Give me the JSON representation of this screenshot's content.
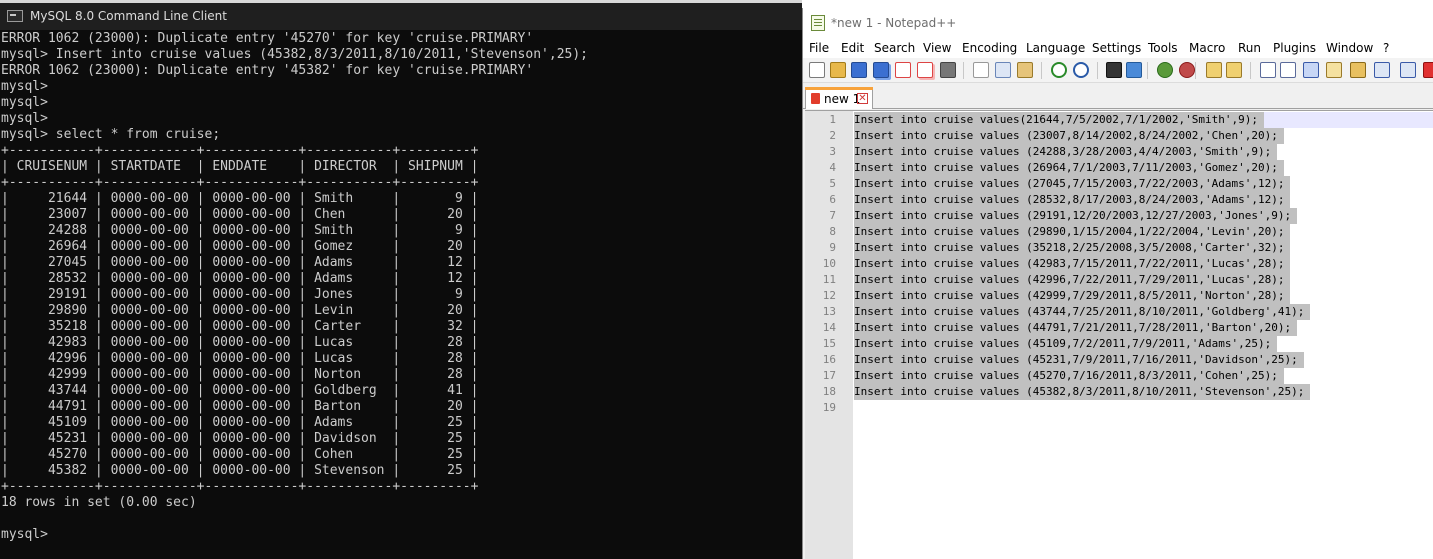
{
  "mysql_window": {
    "title": "MySQL 8.0 Command Line Client",
    "console_lines": [
      "ERROR 1062 (23000): Duplicate entry '45270' for key 'cruise.PRIMARY'",
      "mysql> Insert into cruise values (45382,8/3/2011,8/10/2011,'Stevenson',25);",
      "ERROR 1062 (23000): Duplicate entry '45382' for key 'cruise.PRIMARY'",
      "mysql>",
      "mysql>",
      "mysql>",
      "mysql> select * from cruise;",
      "+-----------+------------+------------+-----------+---------+",
      "| CRUISENUM | STARTDATE  | ENDDATE    | DIRECTOR  | SHIPNUM |",
      "+-----------+------------+------------+-----------+---------+",
      "|     21644 | 0000-00-00 | 0000-00-00 | Smith     |       9 |",
      "|     23007 | 0000-00-00 | 0000-00-00 | Chen      |      20 |",
      "|     24288 | 0000-00-00 | 0000-00-00 | Smith     |       9 |",
      "|     26964 | 0000-00-00 | 0000-00-00 | Gomez     |      20 |",
      "|     27045 | 0000-00-00 | 0000-00-00 | Adams     |      12 |",
      "|     28532 | 0000-00-00 | 0000-00-00 | Adams     |      12 |",
      "|     29191 | 0000-00-00 | 0000-00-00 | Jones     |       9 |",
      "|     29890 | 0000-00-00 | 0000-00-00 | Levin     |      20 |",
      "|     35218 | 0000-00-00 | 0000-00-00 | Carter    |      32 |",
      "|     42983 | 0000-00-00 | 0000-00-00 | Lucas     |      28 |",
      "|     42996 | 0000-00-00 | 0000-00-00 | Lucas     |      28 |",
      "|     42999 | 0000-00-00 | 0000-00-00 | Norton    |      28 |",
      "|     43744 | 0000-00-00 | 0000-00-00 | Goldberg  |      41 |",
      "|     44791 | 0000-00-00 | 0000-00-00 | Barton    |      20 |",
      "|     45109 | 0000-00-00 | 0000-00-00 | Adams     |      25 |",
      "|     45231 | 0000-00-00 | 0000-00-00 | Davidson  |      25 |",
      "|     45270 | 0000-00-00 | 0000-00-00 | Cohen     |      25 |",
      "|     45382 | 0000-00-00 | 0000-00-00 | Stevenson |      25 |",
      "+-----------+------------+------------+-----------+---------+",
      "18 rows in set (0.00 sec)",
      "",
      "mysql>"
    ]
  },
  "notepad_window": {
    "title": "*new 1 - Notepad++",
    "menu": [
      "File",
      "Edit",
      "Search",
      "View",
      "Encoding",
      "Language",
      "Settings",
      "Tools",
      "Macro",
      "Run",
      "Plugins",
      "Window",
      "?"
    ],
    "toolbar_icons": [
      "new-file-icon",
      "open-file-icon",
      "save-icon",
      "save-all-icon",
      "close-icon",
      "close-all-icon",
      "print-icon",
      "cut-icon",
      "copy-icon",
      "paste-icon",
      "undo-icon",
      "redo-icon",
      "find-icon",
      "replace-icon",
      "zoom-in-icon",
      "zoom-out-icon",
      "sync-vertical-icon",
      "sync-horizontal-icon",
      "word-wrap-icon",
      "show-all-chars-icon",
      "indent-guide-icon",
      "language-icon",
      "document-map-icon",
      "function-list-icon",
      "folder-workspace-icon",
      "monitoring-icon"
    ],
    "tab": {
      "label": "new 1"
    },
    "lines": [
      "Insert into cruise values(21644,7/5/2002,7/1/2002,'Smith',9);",
      "Insert into cruise values (23007,8/14/2002,8/24/2002,'Chen',20);",
      "Insert into cruise values (24288,3/28/2003,4/4/2003,'Smith',9);",
      "Insert into cruise values (26964,7/1/2003,7/11/2003,'Gomez',20);",
      "Insert into cruise values (27045,7/15/2003,7/22/2003,'Adams',12);",
      "Insert into cruise values (28532,8/17/2003,8/24/2003,'Adams',12);",
      "Insert into cruise values (29191,12/20/2003,12/27/2003,'Jones',9);",
      "Insert into cruise values (29890,1/15/2004,1/22/2004,'Levin',20);",
      "Insert into cruise values (35218,2/25/2008,3/5/2008,'Carter',32);",
      "Insert into cruise values (42983,7/15/2011,7/22/2011,'Lucas',28);",
      "Insert into cruise values (42996,7/22/2011,7/29/2011,'Lucas',28);",
      "Insert into cruise values (42999,7/29/2011,8/5/2011,'Norton',28);",
      "Insert into cruise values (43744,7/25/2011,8/10/2011,'Goldberg',41);",
      "Insert into cruise values (44791,7/21/2011,7/28/2011,'Barton',20);",
      "Insert into cruise values (45109,7/2/2011,7/9/2011,'Adams',25);",
      "Insert into cruise values (45231,7/9/2011,7/16/2011,'Davidson',25);",
      "Insert into cruise values (45270,7/16/2011,8/3/2011,'Cohen',25);",
      "Insert into cruise values (45382,8/3/2011,8/10/2011,'Stevenson',25);",
      ""
    ],
    "line_numbers": [
      "1",
      "2",
      "3",
      "4",
      "5",
      "6",
      "7",
      "8",
      "9",
      "10",
      "11",
      "12",
      "13",
      "14",
      "15",
      "16",
      "17",
      "18",
      "19"
    ]
  }
}
